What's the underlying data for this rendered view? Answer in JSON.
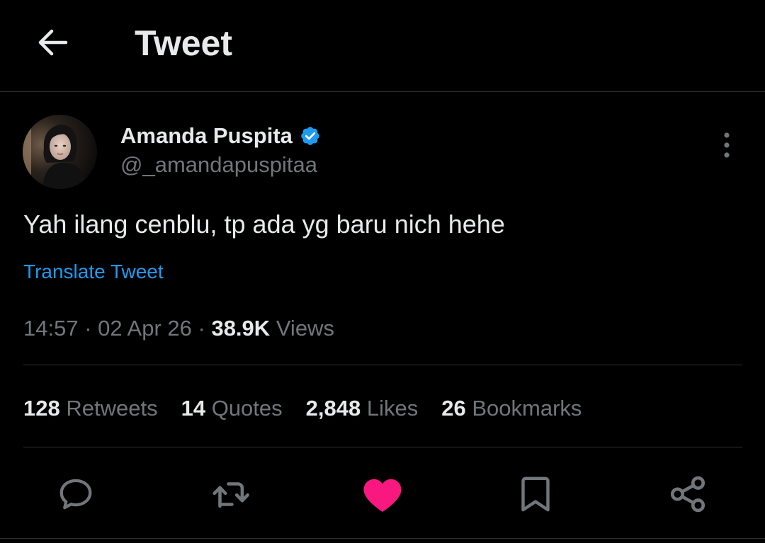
{
  "header": {
    "back_icon": "arrow-left-icon",
    "title": "Tweet"
  },
  "tweet": {
    "author": {
      "name": "Amanda Puspita",
      "handle": "@_amandapuspitaa",
      "verified_icon": "verified-badge-icon",
      "verified_color": "#1d9bf0"
    },
    "more_icon": "more-vertical-icon",
    "text": "Yah ilang cenblu, tp ada yg baru nich hehe",
    "translate_label": "Translate Tweet",
    "time": "14:57",
    "separator": "·",
    "date": "02 Apr 26",
    "views_count": "38.9K",
    "views_label": "Views"
  },
  "stats": [
    {
      "count": "128",
      "label": "Retweets"
    },
    {
      "count": "14",
      "label": "Quotes"
    },
    {
      "count": "2,848",
      "label": "Likes"
    },
    {
      "count": "26",
      "label": "Bookmarks"
    }
  ],
  "actions": [
    {
      "icon": "reply-icon"
    },
    {
      "icon": "retweet-icon"
    },
    {
      "icon": "heart-filled-icon",
      "color": "#f91880",
      "liked": true
    },
    {
      "icon": "bookmark-icon"
    },
    {
      "icon": "share-icon"
    }
  ],
  "colors": {
    "background": "#000000",
    "text_primary": "#e7e9ea",
    "text_secondary": "#71767b",
    "link": "#1d9bf0",
    "like": "#f91880",
    "divider": "#2f3336"
  }
}
